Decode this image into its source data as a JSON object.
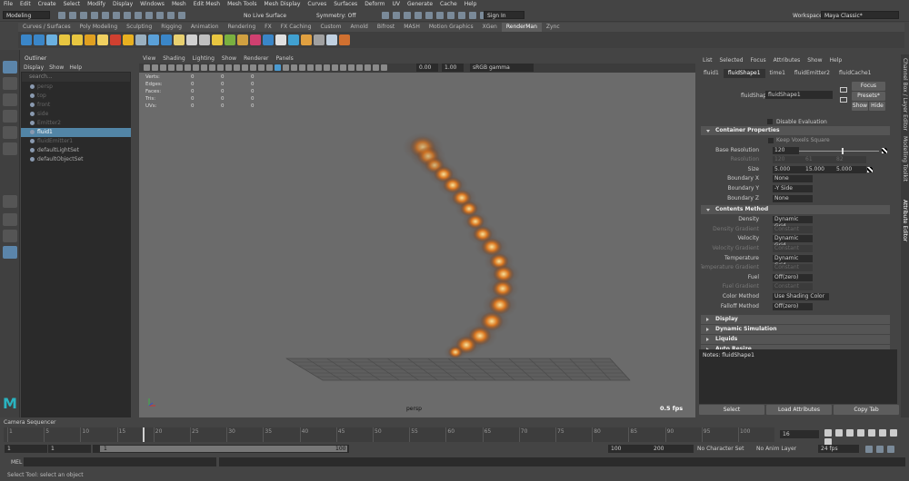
{
  "menus": [
    "File",
    "Edit",
    "Create",
    "Select",
    "Modify",
    "Display",
    "Windows",
    "Mesh",
    "Edit Mesh",
    "Mesh Tools",
    "Mesh Display",
    "Curves",
    "Surfaces",
    "Deform",
    "UV",
    "Generate",
    "Cache",
    "Help"
  ],
  "status": {
    "mode": "Modeling",
    "live_surface": "No Live Surface",
    "symmetry": "Symmetry: Off",
    "sign_in": "Sign In",
    "workspace_label": "Workspace:",
    "workspace": "Maya Classic*"
  },
  "shelf_tabs": [
    "Curves / Surfaces",
    "Poly Modeling",
    "Sculpting",
    "Rigging",
    "Animation",
    "Rendering",
    "FX",
    "FX Caching",
    "Custom",
    "Arnold",
    "Bifrost",
    "MASH",
    "Motion Graphics",
    "XGen",
    "RenderMan",
    "Zync"
  ],
  "active_shelf_tab": "RenderMan",
  "outliner": {
    "title": "Outliner",
    "menu": [
      "Display",
      "Show",
      "Help"
    ],
    "search": "search...",
    "items": [
      {
        "label": "persp",
        "dim": true
      },
      {
        "label": "top",
        "dim": true
      },
      {
        "label": "front",
        "dim": true
      },
      {
        "label": "side",
        "dim": true
      },
      {
        "label": "Emitter2",
        "dim": true
      },
      {
        "label": "fluid1",
        "sel": true
      },
      {
        "label": "fluidEmitter1",
        "dim": true
      },
      {
        "label": "defaultLightSet"
      },
      {
        "label": "defaultObjectSet"
      }
    ]
  },
  "viewport": {
    "menu": [
      "View",
      "Shading",
      "Lighting",
      "Show",
      "Renderer",
      "Panels"
    ],
    "field_a": "0.00",
    "field_b": "1.00",
    "color_space": "sRGB gamma",
    "hud": [
      {
        "k": "Verts:",
        "a": "0",
        "b": "0",
        "c": "0"
      },
      {
        "k": "Edges:",
        "a": "0",
        "b": "0",
        "c": "0"
      },
      {
        "k": "Faces:",
        "a": "0",
        "b": "0",
        "c": "0"
      },
      {
        "k": "Tris:",
        "a": "0",
        "b": "0",
        "c": "0"
      },
      {
        "k": "UVs:",
        "a": "0",
        "b": "0",
        "c": "0"
      }
    ],
    "camera": "persp",
    "fps": "0.5 fps"
  },
  "ae": {
    "menu": [
      "List",
      "Selected",
      "Focus",
      "Attributes",
      "Show",
      "Help"
    ],
    "tabs": [
      "fluid1",
      "fluidShape1",
      "time1",
      "fluidEmitter2",
      "fluidCache1"
    ],
    "active_tab": "fluidShape1",
    "shape_label": "fluidShape:",
    "shape_value": "fluidShape1",
    "focus": "Focus",
    "presets": "Presets*",
    "show": "Show",
    "hide": "Hide",
    "disable_eval": "Disable Evaluation",
    "container": "Container Properties",
    "keep_square": "Keep Voxels Square",
    "base_res_label": "Base Resolution",
    "base_res": "120",
    "res_label": "Resolution",
    "res": [
      "120",
      "61",
      "82"
    ],
    "size_label": "Size",
    "size": [
      "5.000",
      "15.000",
      "5.000"
    ],
    "boundaries": [
      {
        "k": "Boundary X",
        "v": "None"
      },
      {
        "k": "Boundary Y",
        "v": "-Y Side"
      },
      {
        "k": "Boundary Z",
        "v": "None"
      }
    ],
    "contents": "Contents Method",
    "contents_attrs": [
      {
        "k": "Density",
        "v": "Dynamic Grid",
        "dim": false
      },
      {
        "k": "Density Gradient",
        "v": "Constant",
        "dim": true
      },
      {
        "k": "Velocity",
        "v": "Dynamic Grid",
        "dim": false
      },
      {
        "k": "Velocity Gradient",
        "v": "Constant",
        "dim": true
      },
      {
        "k": "Temperature",
        "v": "Dynamic Grid",
        "dim": false
      },
      {
        "k": "Temperature Gradient",
        "v": "Constant",
        "dim": true
      },
      {
        "k": "Fuel",
        "v": "Off(zero)",
        "dim": false
      },
      {
        "k": "Fuel Gradient",
        "v": "Constant",
        "dim": true
      },
      {
        "k": "Color Method",
        "v": "Use Shading Color",
        "dim": false
      },
      {
        "k": "Falloff Method",
        "v": "Off(zero)",
        "dim": false
      }
    ],
    "collapsed": [
      "Display",
      "Dynamic Simulation",
      "Liquids",
      "Auto Resize"
    ],
    "notes": "Notes:  fluidShape1",
    "select": "Select",
    "load": "Load Attributes",
    "copy": "Copy Tab"
  },
  "right_tabs": [
    "Channel Box / Layer Editor",
    "Modelling Toolkit",
    "Attribute Editor"
  ],
  "timeline": {
    "title": "Camera Sequencer",
    "ticks": [
      "1",
      "5",
      "10",
      "15",
      "20",
      "25",
      "30",
      "35",
      "40",
      "45",
      "50",
      "55",
      "60",
      "65",
      "70",
      "75",
      "80",
      "85",
      "90",
      "95",
      "100"
    ],
    "current": "16",
    "start": "1",
    "start2": "1",
    "range_start": "1",
    "range_end": "100",
    "end": "100",
    "end2": "200",
    "character": "No Character Set",
    "anim_layer": "No Anim Layer",
    "fps": "24 fps",
    "mel": "MEL",
    "help": "Select Tool: select an object"
  }
}
